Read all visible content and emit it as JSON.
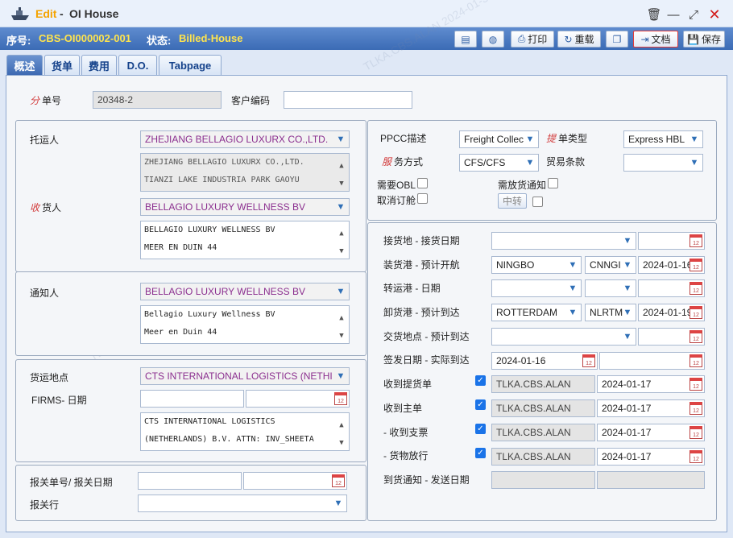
{
  "window": {
    "app": "Edit",
    "sep": "-",
    "title": "OI House"
  },
  "info": {
    "seq_label": "序号:",
    "seq_value": "CBS-OI000002-001",
    "status_label": "状态:",
    "status_value": "Billed-House"
  },
  "toolbar": {
    "print": "打印",
    "reset": "重载",
    "doc": "文档",
    "save": "保存"
  },
  "tabs": [
    "概述",
    "货单",
    "费用",
    "D.O.",
    "Tabpage"
  ],
  "top": {
    "hbl_lbl_em": "分",
    "hbl_lbl": "单号",
    "hbl_value": "20348-2",
    "cust_lbl": "客户编码",
    "cust_value": ""
  },
  "shipper": {
    "lbl": "托运人",
    "name": "ZHEJIANG BELLAGIO LUXURX CO.,LTD.",
    "addr1": "ZHEJIANG BELLAGIO LUXURX CO.,LTD.",
    "addr2": "TIANZI LAKE INDUSTRIA PARK GAOYU"
  },
  "consignee": {
    "lbl_em": "收",
    "lbl": "货人",
    "name": "BELLAGIO LUXURY WELLNESS BV",
    "addr1": "BELLAGIO LUXURY WELLNESS BV",
    "addr2": "MEER EN DUIN 44"
  },
  "notify": {
    "lbl": "通知人",
    "name": "BELLAGIO LUXURY WELLNESS BV",
    "addr1": "Bellagio Luxury Wellness BV",
    "addr2": "Meer en Duin 44"
  },
  "delivery": {
    "lbl": "货运地点",
    "name": "CTS INTERNATIONAL LOGISTICS (NETHI",
    "firms_lbl": "FIRMS- 日期",
    "addr1": "CTS INTERNATIONAL LOGISTICS",
    "addr2": "(NETHERLANDS) B.V. ATTN: INV_SHEETA"
  },
  "customs": {
    "lbl": "报关单号/ 报关日期",
    "broker_lbl": "报关行"
  },
  "right_top": {
    "ppcc_lbl": "PPCC描述",
    "ppcc_value": "Freight Collec",
    "bltype_em": "提",
    "bltype_lbl": "单类型",
    "bltype_value": "Express HBL",
    "svc_em": "服",
    "svc_lbl": "务方式",
    "svc_value": "CFS/CFS",
    "trade_lbl": "贸易条款",
    "obl_lbl": "需要OBL",
    "release_lbl": "需放货通知",
    "cancel_lbl": "取消订舱",
    "transfer_btn": "中转"
  },
  "route": {
    "receipt_lbl": "接货地 - 接货日期",
    "pol_lbl": "装货港 - 预计开航",
    "pol": "NINGBO",
    "pol_code": "CNNGI",
    "etd": "2024-01-16",
    "transit_lbl": "转运港 - 日期",
    "pod_lbl": "卸货港 - 预计到达",
    "pod": "ROTTERDAM",
    "pod_code": "NLRTM",
    "eta": "2024-01-19",
    "dest_lbl": "交货地点 - 预计到达",
    "issue_lbl": "签发日期 - 实际到达",
    "issue": "2024-01-16",
    "recv_bl_lbl": "收到提货单",
    "recv_bl_user": "TLKA.CBS.ALAN",
    "recv_bl_date": "2024-01-17",
    "recv_mbl_lbl": "收到主单",
    "recv_mbl_user": "TLKA.CBS.ALAN",
    "recv_mbl_date": "2024-01-17",
    "recv_chk_lbl": "- 收到支票",
    "recv_chk_user": "TLKA.CBS.ALAN",
    "recv_chk_date": "2024-01-17",
    "release_lbl": "- 货物放行",
    "release_user": "TLKA.CBS.ALAN",
    "release_date": "2024-01-17",
    "arrival_lbl": "到货通知 - 发送日期"
  }
}
